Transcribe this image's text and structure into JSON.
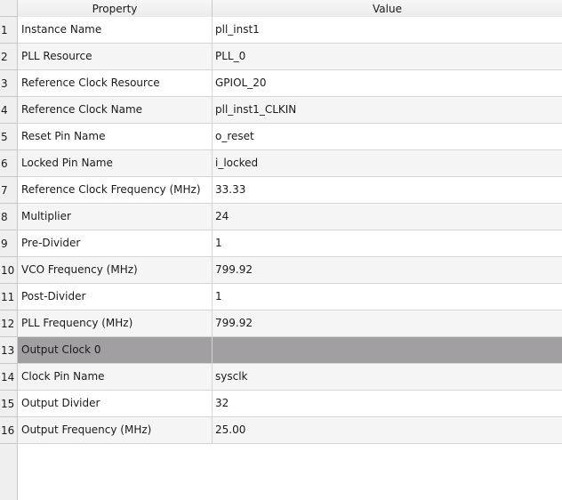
{
  "header": {
    "property_label": "Property",
    "value_label": "Value"
  },
  "rows": [
    {
      "num": "1",
      "property": "Instance Name",
      "value": "pll_inst1"
    },
    {
      "num": "2",
      "property": "PLL Resource",
      "value": "PLL_0"
    },
    {
      "num": "3",
      "property": "Reference Clock Resource",
      "value": "GPIOL_20"
    },
    {
      "num": "4",
      "property": "Reference Clock Name",
      "value": "pll_inst1_CLKIN"
    },
    {
      "num": "5",
      "property": "Reset Pin Name",
      "value": "o_reset"
    },
    {
      "num": "6",
      "property": "Locked Pin Name",
      "value": "i_locked"
    },
    {
      "num": "7",
      "property": "Reference Clock Frequency (MHz)",
      "value": "33.33"
    },
    {
      "num": "8",
      "property": "Multiplier",
      "value": "24"
    },
    {
      "num": "9",
      "property": "Pre-Divider",
      "value": "1"
    },
    {
      "num": "10",
      "property": "VCO Frequency (MHz)",
      "value": "799.92"
    },
    {
      "num": "11",
      "property": "Post-Divider",
      "value": "1"
    },
    {
      "num": "12",
      "property": "PLL Frequency (MHz)",
      "value": "799.92"
    },
    {
      "num": "13",
      "property": "Output Clock 0",
      "value": ""
    },
    {
      "num": "14",
      "property": "Clock Pin Name",
      "value": "sysclk"
    },
    {
      "num": "15",
      "property": "Output Divider",
      "value": "32"
    },
    {
      "num": "16",
      "property": "Output Frequency (MHz)",
      "value": "25.00"
    }
  ],
  "colors": {
    "group_row": "#a29fa3",
    "alt_row": "#f5f5f5",
    "header_bg": "#efefef"
  }
}
